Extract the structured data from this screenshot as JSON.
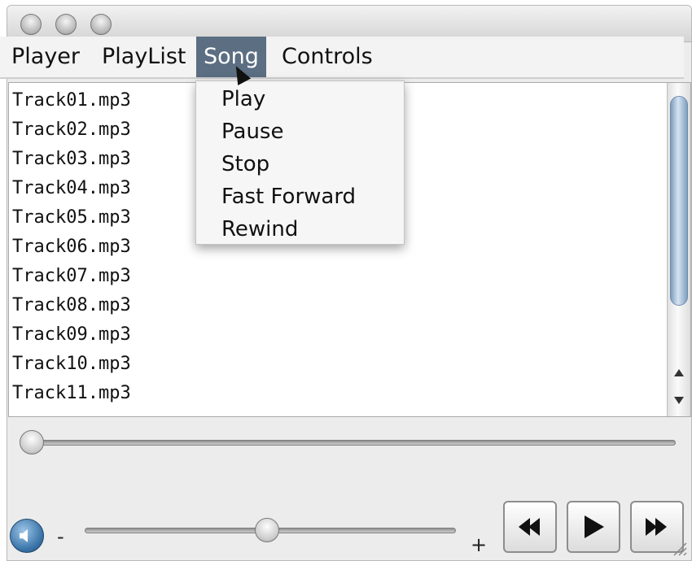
{
  "menubar": {
    "items": [
      {
        "label": "Player"
      },
      {
        "label": "PlayList"
      },
      {
        "label": "Song"
      },
      {
        "label": "Controls"
      }
    ]
  },
  "song_menu": {
    "items": [
      {
        "label": "Play"
      },
      {
        "label": "Pause"
      },
      {
        "label": "Stop"
      },
      {
        "label": "Fast Forward"
      },
      {
        "label": "Rewind"
      }
    ]
  },
  "playlist": {
    "tracks": [
      "Track01.mp3",
      "Track02.mp3",
      "Track03.mp3",
      "Track04.mp3",
      "Track05.mp3",
      "Track06.mp3",
      "Track07.mp3",
      "Track08.mp3",
      "Track09.mp3",
      "Track10.mp3",
      "Track11.mp3"
    ]
  },
  "progress": {
    "value": 0.0
  },
  "volume": {
    "minus_label": "-",
    "plus_label": "+",
    "value": 0.49
  },
  "controls": {
    "rewind_icon": "rewind-icon",
    "play_icon": "play-icon",
    "forward_icon": "fast-forward-icon"
  },
  "colors": {
    "menu_highlight": "#5b6e82",
    "scroll_thumb": "#7d9ebd",
    "volume_icon": "#3a74a8"
  }
}
